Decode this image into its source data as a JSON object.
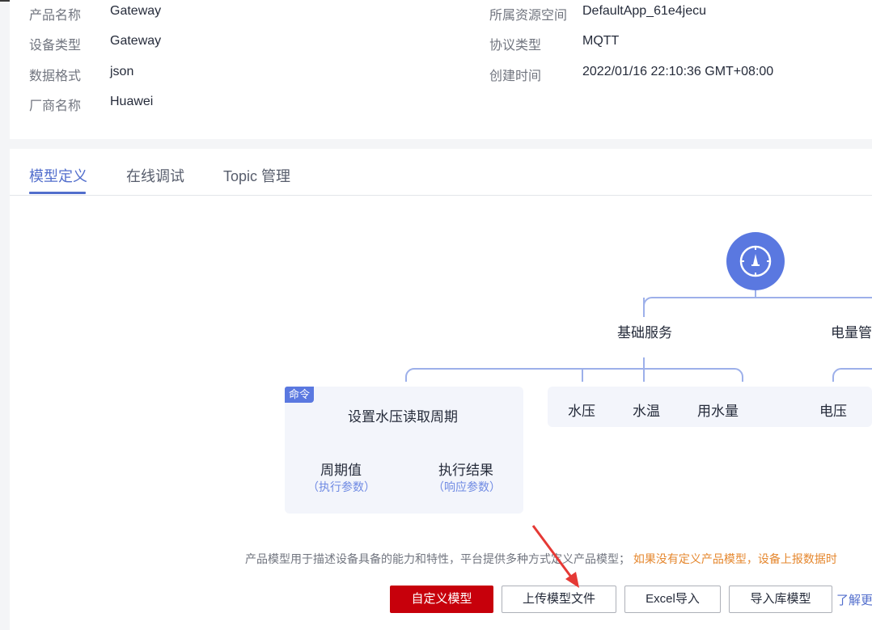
{
  "product_info": {
    "left": [
      {
        "label": "产品名称",
        "value": "Gateway"
      },
      {
        "label": "设备类型",
        "value": "Gateway"
      },
      {
        "label": "数据格式",
        "value": "json"
      },
      {
        "label": "厂商名称",
        "value": "Huawei"
      }
    ],
    "right": [
      {
        "label": "所属资源空间",
        "value": "DefaultApp_61e4jecu"
      },
      {
        "label": "协议类型",
        "value": "MQTT"
      },
      {
        "label": "创建时间",
        "value": "2022/01/16 22:10:36 GMT+08:00"
      }
    ]
  },
  "tabs": [
    {
      "label": "模型定义",
      "active": true
    },
    {
      "label": "在线调试",
      "active": false
    },
    {
      "label": "Topic 管理",
      "active": false
    }
  ],
  "diagram": {
    "root_icon": "compass-icon",
    "services": [
      "基础服务",
      "电量管"
    ],
    "command": {
      "badge": "命令",
      "name": "设置水压读取周期",
      "params": [
        {
          "name": "周期值",
          "role": "（执行参数）"
        },
        {
          "name": "执行结果",
          "role": "（响应参数）"
        }
      ]
    },
    "properties": [
      "水压",
      "水温",
      "用水量"
    ],
    "power_properties": [
      "电压"
    ]
  },
  "description": {
    "text": "产品模型用于描述设备具备的能力和特性，平台提供多种方式定义产品模型；",
    "warning": "如果没有定义产品模型，设备上报数据时"
  },
  "actions": {
    "custom_model": "自定义模型",
    "upload_model": "上传模型文件",
    "excel_import": "Excel导入",
    "import_library": "导入库模型",
    "learn_more": "了解更"
  },
  "colors": {
    "accent": "#526ecc",
    "primary_button": "#c7000b",
    "warning_text": "#e5872e",
    "arrow": "#e53935"
  }
}
